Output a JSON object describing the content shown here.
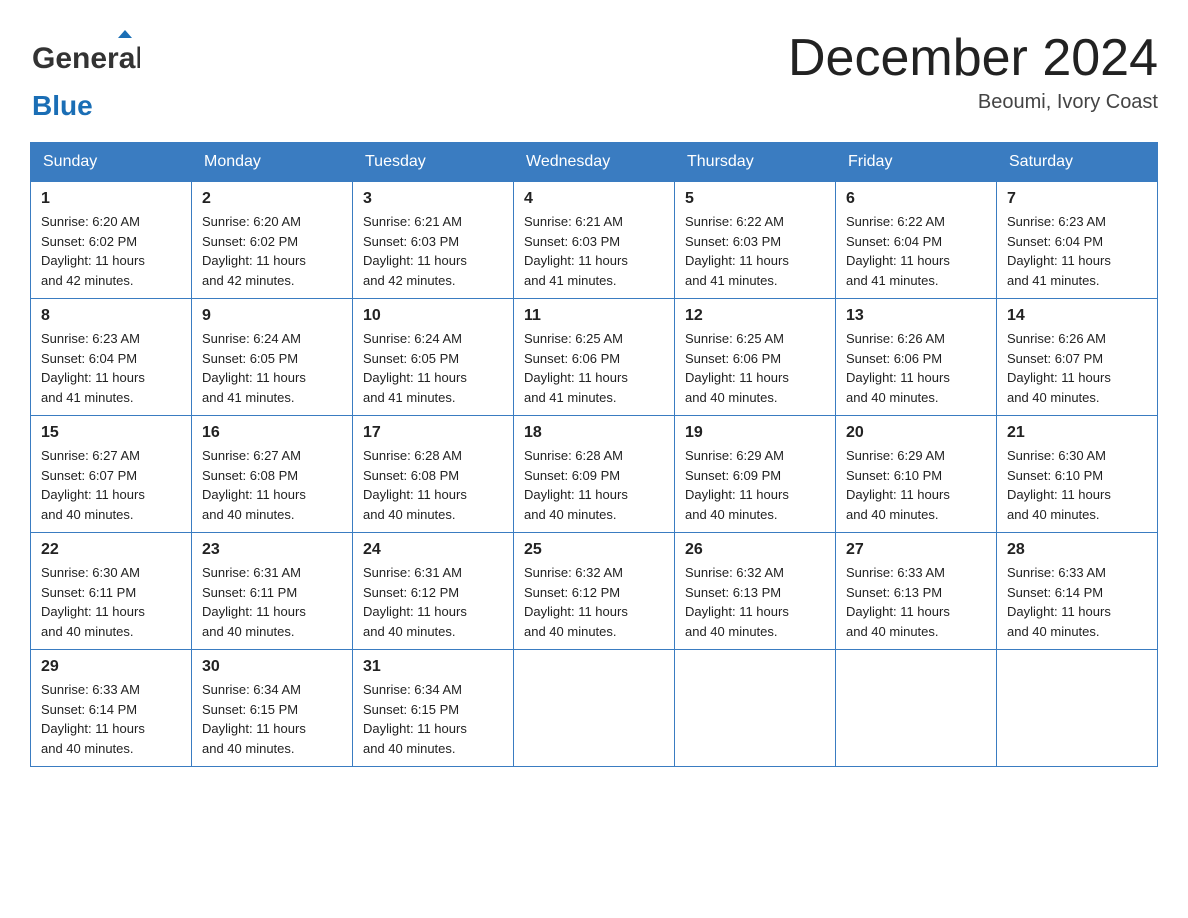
{
  "header": {
    "logo_line1": "General",
    "logo_line2": "Blue",
    "month": "December 2024",
    "location": "Beoumi, Ivory Coast"
  },
  "weekdays": [
    "Sunday",
    "Monday",
    "Tuesday",
    "Wednesday",
    "Thursday",
    "Friday",
    "Saturday"
  ],
  "weeks": [
    [
      {
        "day": "1",
        "sunrise": "6:20 AM",
        "sunset": "6:02 PM",
        "daylight": "11 hours and 42 minutes."
      },
      {
        "day": "2",
        "sunrise": "6:20 AM",
        "sunset": "6:02 PM",
        "daylight": "11 hours and 42 minutes."
      },
      {
        "day": "3",
        "sunrise": "6:21 AM",
        "sunset": "6:03 PM",
        "daylight": "11 hours and 42 minutes."
      },
      {
        "day": "4",
        "sunrise": "6:21 AM",
        "sunset": "6:03 PM",
        "daylight": "11 hours and 41 minutes."
      },
      {
        "day": "5",
        "sunrise": "6:22 AM",
        "sunset": "6:03 PM",
        "daylight": "11 hours and 41 minutes."
      },
      {
        "day": "6",
        "sunrise": "6:22 AM",
        "sunset": "6:04 PM",
        "daylight": "11 hours and 41 minutes."
      },
      {
        "day": "7",
        "sunrise": "6:23 AM",
        "sunset": "6:04 PM",
        "daylight": "11 hours and 41 minutes."
      }
    ],
    [
      {
        "day": "8",
        "sunrise": "6:23 AM",
        "sunset": "6:04 PM",
        "daylight": "11 hours and 41 minutes."
      },
      {
        "day": "9",
        "sunrise": "6:24 AM",
        "sunset": "6:05 PM",
        "daylight": "11 hours and 41 minutes."
      },
      {
        "day": "10",
        "sunrise": "6:24 AM",
        "sunset": "6:05 PM",
        "daylight": "11 hours and 41 minutes."
      },
      {
        "day": "11",
        "sunrise": "6:25 AM",
        "sunset": "6:06 PM",
        "daylight": "11 hours and 41 minutes."
      },
      {
        "day": "12",
        "sunrise": "6:25 AM",
        "sunset": "6:06 PM",
        "daylight": "11 hours and 40 minutes."
      },
      {
        "day": "13",
        "sunrise": "6:26 AM",
        "sunset": "6:06 PM",
        "daylight": "11 hours and 40 minutes."
      },
      {
        "day": "14",
        "sunrise": "6:26 AM",
        "sunset": "6:07 PM",
        "daylight": "11 hours and 40 minutes."
      }
    ],
    [
      {
        "day": "15",
        "sunrise": "6:27 AM",
        "sunset": "6:07 PM",
        "daylight": "11 hours and 40 minutes."
      },
      {
        "day": "16",
        "sunrise": "6:27 AM",
        "sunset": "6:08 PM",
        "daylight": "11 hours and 40 minutes."
      },
      {
        "day": "17",
        "sunrise": "6:28 AM",
        "sunset": "6:08 PM",
        "daylight": "11 hours and 40 minutes."
      },
      {
        "day": "18",
        "sunrise": "6:28 AM",
        "sunset": "6:09 PM",
        "daylight": "11 hours and 40 minutes."
      },
      {
        "day": "19",
        "sunrise": "6:29 AM",
        "sunset": "6:09 PM",
        "daylight": "11 hours and 40 minutes."
      },
      {
        "day": "20",
        "sunrise": "6:29 AM",
        "sunset": "6:10 PM",
        "daylight": "11 hours and 40 minutes."
      },
      {
        "day": "21",
        "sunrise": "6:30 AM",
        "sunset": "6:10 PM",
        "daylight": "11 hours and 40 minutes."
      }
    ],
    [
      {
        "day": "22",
        "sunrise": "6:30 AM",
        "sunset": "6:11 PM",
        "daylight": "11 hours and 40 minutes."
      },
      {
        "day": "23",
        "sunrise": "6:31 AM",
        "sunset": "6:11 PM",
        "daylight": "11 hours and 40 minutes."
      },
      {
        "day": "24",
        "sunrise": "6:31 AM",
        "sunset": "6:12 PM",
        "daylight": "11 hours and 40 minutes."
      },
      {
        "day": "25",
        "sunrise": "6:32 AM",
        "sunset": "6:12 PM",
        "daylight": "11 hours and 40 minutes."
      },
      {
        "day": "26",
        "sunrise": "6:32 AM",
        "sunset": "6:13 PM",
        "daylight": "11 hours and 40 minutes."
      },
      {
        "day": "27",
        "sunrise": "6:33 AM",
        "sunset": "6:13 PM",
        "daylight": "11 hours and 40 minutes."
      },
      {
        "day": "28",
        "sunrise": "6:33 AM",
        "sunset": "6:14 PM",
        "daylight": "11 hours and 40 minutes."
      }
    ],
    [
      {
        "day": "29",
        "sunrise": "6:33 AM",
        "sunset": "6:14 PM",
        "daylight": "11 hours and 40 minutes."
      },
      {
        "day": "30",
        "sunrise": "6:34 AM",
        "sunset": "6:15 PM",
        "daylight": "11 hours and 40 minutes."
      },
      {
        "day": "31",
        "sunrise": "6:34 AM",
        "sunset": "6:15 PM",
        "daylight": "11 hours and 40 minutes."
      },
      null,
      null,
      null,
      null
    ]
  ],
  "labels": {
    "sunrise": "Sunrise:",
    "sunset": "Sunset:",
    "daylight": "Daylight:"
  }
}
